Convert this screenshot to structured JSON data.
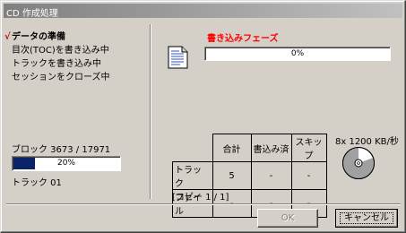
{
  "window": {
    "title": "CD 作成処理"
  },
  "steps": [
    {
      "label": "データの準備",
      "done": true
    },
    {
      "label": "目次(TOC)を書き込み中",
      "done": false
    },
    {
      "label": "トラックを書き込み中",
      "done": false
    },
    {
      "label": "セッションをクローズ中",
      "done": false
    }
  ],
  "check_mark": "√",
  "phase": {
    "title": "書き込みフェーズ",
    "progress_text": "0%",
    "progress": 0.0
  },
  "block": {
    "label": "ブロック 3673 / 17971",
    "progress_text": "20%",
    "progress": 0.2
  },
  "track": {
    "label": "トラック 01"
  },
  "stats": {
    "headers": [
      "合計",
      "書込み済",
      "スキップ"
    ],
    "rows": [
      {
        "label": "トラック",
        "values": [
          "5",
          "-",
          "-"
        ]
      },
      {
        "label": "ファイル",
        "values": [
          "-",
          "-",
          "-"
        ]
      }
    ]
  },
  "copy": {
    "label": "[コピー 1 / 1]"
  },
  "speed": {
    "label": "8x 1200 KB/秒"
  },
  "buttons": {
    "ok": "OK",
    "cancel": "キャンセル"
  },
  "colors": {
    "phase_title": "#ff0000",
    "progress_fill": "#0a246a",
    "check": "#cc0000"
  }
}
